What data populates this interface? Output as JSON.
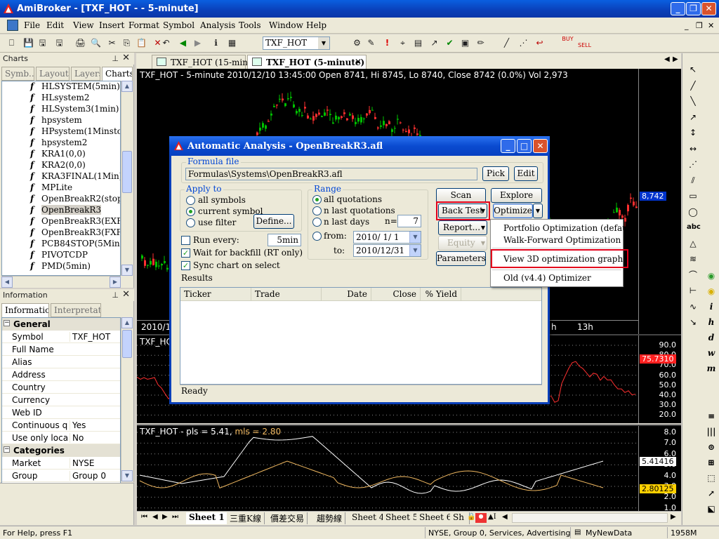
{
  "app": {
    "title": "AmiBroker - [TXF_HOT -  - 5-minute]",
    "min_glyph": "_",
    "restore_glyph": "❐",
    "close_glyph": "✕"
  },
  "menu": {
    "items": [
      "File",
      "Edit",
      "View",
      "Insert",
      "Format",
      "Symbol",
      "Analysis",
      "Tools",
      "Window",
      "Help"
    ],
    "mdi_min": "_",
    "mdi_restore": "❐",
    "mdi_close": "✕"
  },
  "toolbar": {
    "symbol_value": "TXF_HOT",
    "icons": [
      "⎕",
      "💾",
      "🖫",
      "🖨",
      "🔍",
      "✂",
      "⎘",
      "📋",
      "✕",
      "↶",
      "◀",
      "▶",
      "ℹ",
      "▦",
      "⚙",
      "✎",
      "!",
      "⌖",
      "▤",
      "↗",
      "✔",
      "▣",
      "✏",
      "╱",
      "⋰",
      "↩",
      "BUY",
      "SELL"
    ]
  },
  "charts_panel": {
    "title": "Charts",
    "pin": "📌",
    "close": "✕",
    "tabs": [
      "Symb...",
      "Layouts",
      "Layers",
      "Charts"
    ],
    "active_tab": "Charts",
    "formula_glyph": "f",
    "items": [
      "HLSYSTEM(5min)",
      "HLsystem2",
      "HLSystem3(1min)",
      "hpsystem",
      "HPsystem(1Minstop)",
      "hpsystem2",
      "KRA1(0,0)",
      "KRA2(0,0)",
      "KRA3FINAL(1Min)",
      "MPLite",
      "OpenBreakR2(stop15m",
      "OpenBreakR3",
      "OpenBreakR3(EXF)",
      "OpenBreakR3(FXF)",
      "PCB84STOP(5Min)",
      "PIVOTCDP",
      "PMD(5min)"
    ],
    "selected": "OpenBreakR3"
  },
  "info_panel": {
    "title": "Information",
    "tabs": [
      "Information",
      "Interpretation"
    ],
    "categories": [
      {
        "name": "General",
        "rows": [
          {
            "k": "Symbol",
            "v": "TXF_HOT"
          },
          {
            "k": "Full Name",
            "v": ""
          },
          {
            "k": "Alias",
            "v": ""
          },
          {
            "k": "Address",
            "v": ""
          },
          {
            "k": "Country",
            "v": ""
          },
          {
            "k": "Currency",
            "v": ""
          },
          {
            "k": "Web ID",
            "v": ""
          },
          {
            "k": "Continuous qu",
            "v": "Yes"
          },
          {
            "k": "Use only local",
            "v": "No"
          }
        ]
      },
      {
        "name": "Categories",
        "rows": [
          {
            "k": "Market",
            "v": "NYSE"
          },
          {
            "k": "Group",
            "v": "Group 0"
          }
        ]
      }
    ]
  },
  "doc_tabs": [
    {
      "label": "TXF_HOT (15-minute)",
      "active": false
    },
    {
      "label": "TXF_HOT (5-minute)",
      "active": true,
      "close": "✕"
    }
  ],
  "chart": {
    "header": "TXF_HOT - 5-minute 2010/12/10 13:45:00 Open 8741, Hi 8745, Lo 8740, Close 8742 (0.0%) Vol 2,973",
    "price_label": "8,742",
    "x_ticks": [
      "2010/1",
      "h",
      "13h"
    ],
    "pane2_title": "TXF_HO",
    "pane2_yaxis": [
      "90.0",
      "80.0",
      "70.0",
      "60.0",
      "50.0",
      "40.0",
      "30.0",
      "20.0"
    ],
    "pane2_label": "75.7310",
    "pane3_title_prefix": "TXF_HOT - ",
    "pane3_pls": "pls = 5.41",
    "pane3_sep": ", ",
    "pane3_mls": "mls = 2.80",
    "pane3_yaxis": [
      "8.0",
      "7.0",
      "6.0",
      "5.0",
      "4.0",
      "3.0",
      "2.0",
      "1.0"
    ],
    "pane3_label1": "5.41416",
    "pane3_label2": "2.80125",
    "colors": {
      "pls": "#ffffff",
      "mls": "#f0b860",
      "up": "#00c000",
      "down": "#ff3030",
      "rsi": "#ff3030",
      "label_red": "#ff2020",
      "label_blue": "#0033cc",
      "label_yellow": "#ffd000"
    }
  },
  "sheets": {
    "nav": [
      "⏮",
      "◀",
      "▶",
      "⏭"
    ],
    "tabs": [
      "Sheet 1",
      "三重K線",
      "價差交易",
      "趨勢線",
      "Sheet 4",
      "Sheet 5",
      "Sheet 6",
      "Sh"
    ],
    "active": "Sheet 1",
    "lock": "🔒",
    "extra1": "●",
    "extra2": "▲I",
    "left": "◀",
    "right": "▶"
  },
  "drawbar": {
    "icons": [
      "↖",
      "╱",
      "╲",
      "↗",
      "↕",
      "↔",
      "⋰",
      "⫽",
      "▭",
      "◯",
      "abc",
      "△",
      "≋",
      "⌒",
      "⊢",
      "∿",
      "↘"
    ],
    "icons2": [
      "◉",
      "◉",
      "i",
      "h",
      "d",
      "w",
      "m"
    ],
    "icons3": [
      "≡",
      "|||",
      "⊚",
      "⊞",
      "⬚",
      "↗",
      "⬕"
    ]
  },
  "status": {
    "help": "For Help, press F1",
    "market": "NYSE, Group 0, Services, Advertising",
    "db": "MyNewData",
    "mem": "1958M"
  },
  "dialog": {
    "title": "Automatic Analysis - OpenBreakR3.afl",
    "formula_group": "Formula file",
    "formula_path": "Formulas\\Systems\\OpenBreakR3.afl",
    "pick": "Pick",
    "edit": "Edit",
    "apply_group": "Apply to",
    "all_symbols": "all symbols",
    "current_symbol": "current symbol",
    "use_filter": "use filter",
    "define": "Define...",
    "range_group": "Range",
    "all_quotations": "all quotations",
    "n_last_quotations": "n last quotations",
    "n_last_days": "n last days",
    "n_label": "n=",
    "n_value": "7",
    "from_label": "from:",
    "from_value": "2010/ 1/ 1",
    "to_label": "to:",
    "to_value": "2010/12/31",
    "run_every": "Run every:",
    "run_every_value": "5min",
    "wait_backfill": "Wait for backfill (RT only)",
    "sync_chart": "Sync chart on select",
    "scan": "Scan",
    "explore": "Explore",
    "back_test": "Back Test",
    "optimize": "Optimize",
    "report": "Report...",
    "equity": "Equity",
    "parameters": "Parameters",
    "results_label": "Results",
    "columns": [
      "Ticker",
      "Trade",
      "Date",
      "Close",
      "% Yield"
    ],
    "status": "Ready",
    "dropdown_glyph": "▼"
  },
  "optimize_menu": {
    "items": [
      "Portfolio Optimization (default)",
      "Walk-Forward Optimization",
      "View 3D optimization graph",
      "Old (v4.4) Optimizer"
    ],
    "highlighted": "View 3D optimization graph"
  }
}
